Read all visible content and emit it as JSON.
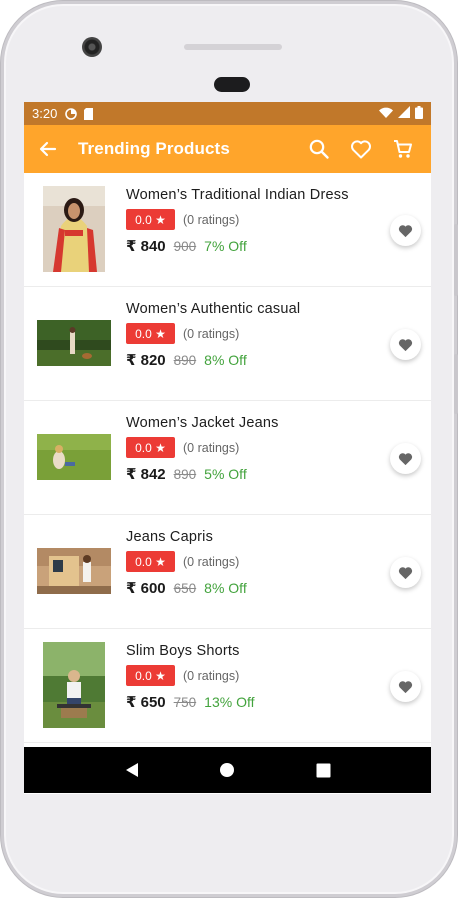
{
  "status_bar": {
    "time": "3:20",
    "left_icons": [
      "data-saver-icon",
      "sd-card-icon"
    ],
    "right_icons": [
      "wifi-icon",
      "signal-icon",
      "battery-icon"
    ]
  },
  "app_bar": {
    "title": "Trending Products",
    "color": "#ffa52b",
    "icons": [
      "back-arrow-icon",
      "search-icon",
      "heart-icon",
      "cart-icon"
    ]
  },
  "currency_symbol": "₹",
  "products": [
    {
      "name": "Women’s Traditional Indian Dress",
      "rating": "0.0 ★",
      "ratings_count": "(0 ratings)",
      "price": "₹ 840",
      "mrp": "900",
      "off": "7% Off"
    },
    {
      "name": "Women’s Authentic casual",
      "rating": "0.0 ★",
      "ratings_count": "(0 ratings)",
      "price": "₹ 820",
      "mrp": "890",
      "off": "8% Off"
    },
    {
      "name": "Women’s Jacket Jeans",
      "rating": "0.0 ★",
      "ratings_count": "(0 ratings)",
      "price": "₹ 842",
      "mrp": "890",
      "off": "5% Off"
    },
    {
      "name": "Jeans Capris",
      "rating": "0.0 ★",
      "ratings_count": "(0 ratings)",
      "price": "₹ 600",
      "mrp": "650",
      "off": "8% Off"
    },
    {
      "name": "Slim Boys Shorts",
      "rating": "0.0 ★",
      "ratings_count": "(0 ratings)",
      "price": "₹ 650",
      "mrp": "750",
      "off": "13% Off"
    }
  ],
  "colors": {
    "status_bar": "#c1782a",
    "rating_badge": "#ec3b35",
    "discount_text": "#43a33d"
  },
  "nav_bar": {
    "icons": [
      "back-triangle-icon",
      "home-circle-icon",
      "recents-square-icon"
    ]
  }
}
